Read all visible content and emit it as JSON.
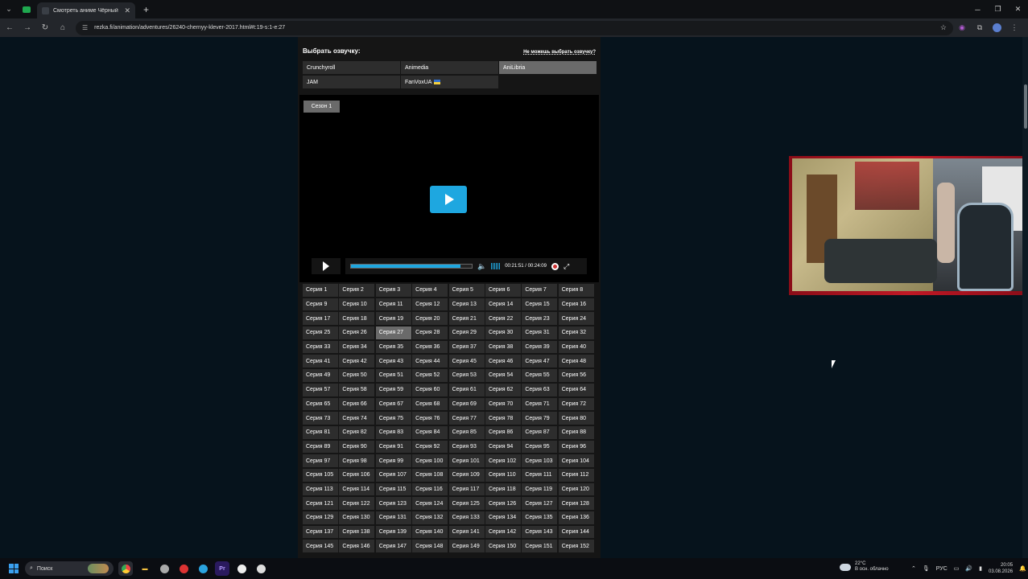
{
  "browser": {
    "tab_title": "Смотреть аниме Чёрный клев",
    "url": "rezka.fi/animation/adventures/26240-chernyy-klever-2017.html#t:19-s:1-e:27"
  },
  "voiceover": {
    "heading": "Выбрать озвучку:",
    "help_link": "Не можешь выбрать озвучку?",
    "options": [
      "Crunchyroll",
      "Animedia",
      "AniLibria",
      "JAM",
      "FanVoxUA"
    ],
    "active": "AniLibria"
  },
  "player": {
    "season": "Сезон 1",
    "time": "00:21:51 / 00:24:09",
    "progress": 0.905,
    "accent": "#1ea7e0"
  },
  "episodes": {
    "label_prefix": "Серия",
    "count_visible": 152,
    "active": 27
  },
  "taskbar": {
    "search_placeholder": "Поиск",
    "weather_temp": "22°C",
    "weather_desc": "В осн. облачно",
    "lang": "РУС",
    "time": "20:05",
    "date": "03.08.2026"
  },
  "icons": [
    "chevron-down-icon",
    "close-icon",
    "plus-icon",
    "back-icon",
    "forward-icon",
    "reload-icon",
    "home-icon",
    "tune-icon",
    "star-icon",
    "extension-icon",
    "profile-icon",
    "more-icon",
    "play-icon",
    "volume-icon",
    "settings-icon",
    "fullscreen-icon",
    "windows-icon",
    "search-icon",
    "chrome-icon",
    "folder-icon",
    "telegram-icon",
    "premiere-icon",
    "cloud-icon",
    "mic-icon",
    "wifi-icon",
    "speaker-icon",
    "bell-icon"
  ]
}
